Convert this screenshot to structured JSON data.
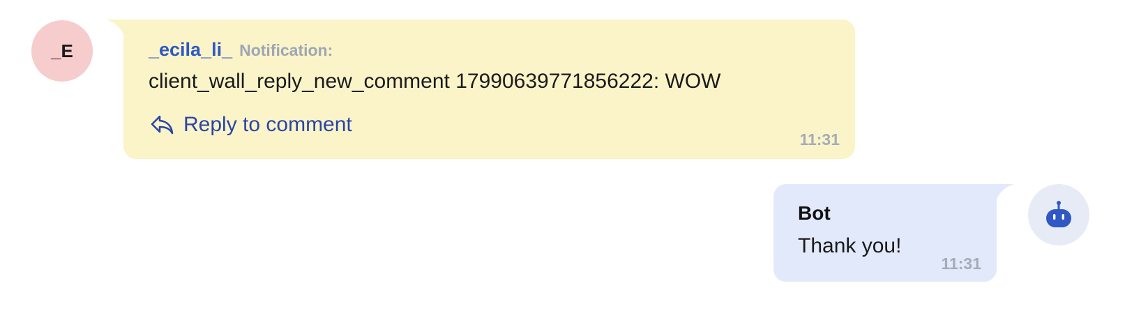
{
  "messages": {
    "incoming": {
      "avatar_initials": "_E",
      "avatar_color": "#f6cccc",
      "sender": "_ecila_li_",
      "tag": "Notification:",
      "text": "client_wall_reply_new_comment 17990639771856222: WOW",
      "reply_label": "Reply to comment",
      "reply_icon": "reply-arrow-icon",
      "time": "11:31",
      "bubble_color": "#fbf4c9"
    },
    "outgoing": {
      "sender": "Bot",
      "text": "Thank you!",
      "time": "11:31",
      "avatar_icon": "robot-icon",
      "bubble_color": "#e2e9fa"
    }
  },
  "colors": {
    "sender_name": "#2f58c4",
    "link": "#2945a6",
    "timestamp": "#a4acb8"
  }
}
